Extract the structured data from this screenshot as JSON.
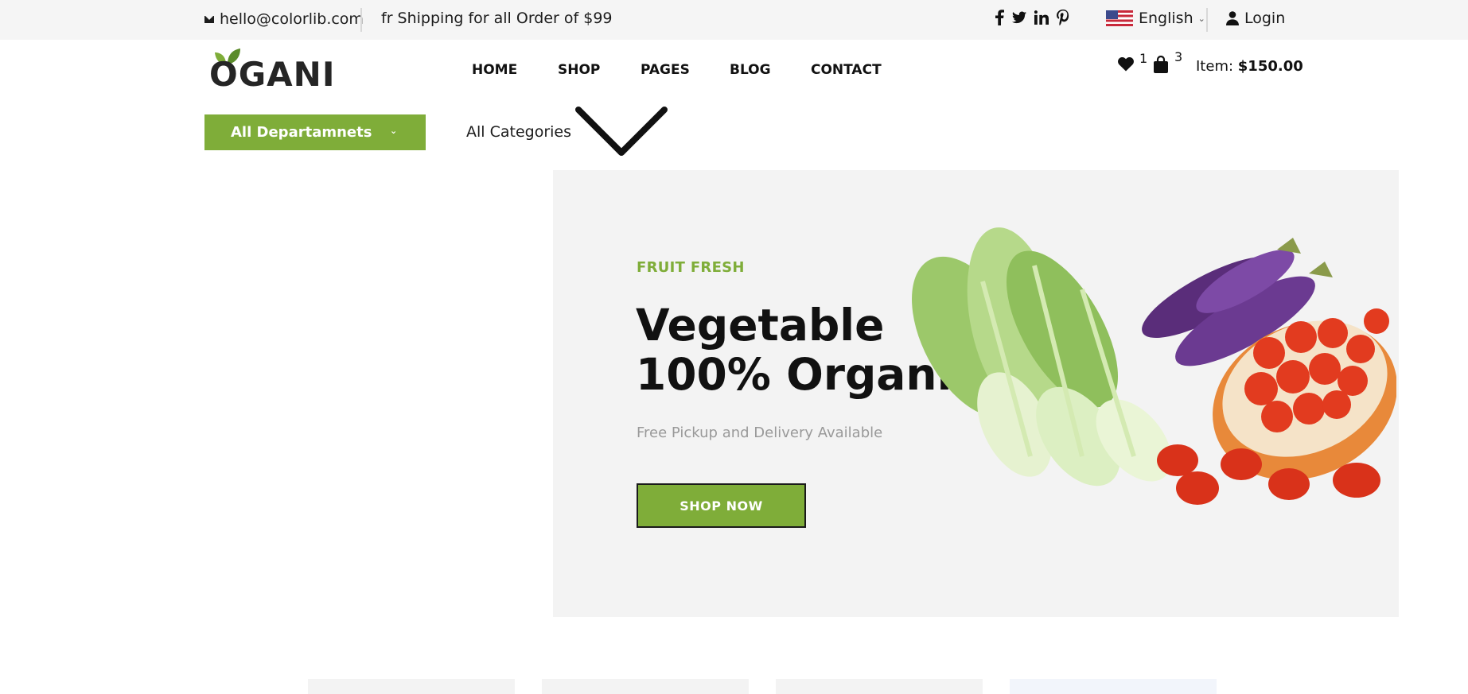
{
  "topbar": {
    "email": "hello@colorlib.com",
    "shipping": "fr Shipping for all Order of $99",
    "social": [
      "facebook-icon",
      "twitter-icon",
      "linkedin-icon",
      "pinterest-icon"
    ],
    "language": "English",
    "login": "Login"
  },
  "header": {
    "logo": "OGANI",
    "nav": [
      "HOME",
      "SHOP",
      "PAGES",
      "BLOG",
      "CONTACT"
    ],
    "wishlist_count": "1",
    "cart_count": "3",
    "item_label": "Item:",
    "item_total": "$150.00"
  },
  "departments": {
    "label": "All Departamnets"
  },
  "categories": {
    "label": "All Categories"
  },
  "hero": {
    "tag": "FRUIT FRESH",
    "title_line1": "Vegetable",
    "title_line2": "100% Organic",
    "subtitle": "Free Pickup and Delivery Available",
    "button": "SHOP NOW"
  },
  "colors": {
    "accent": "#7fad39",
    "topbar_bg": "#f5f5f5",
    "hero_bg": "#f3f3f3"
  }
}
